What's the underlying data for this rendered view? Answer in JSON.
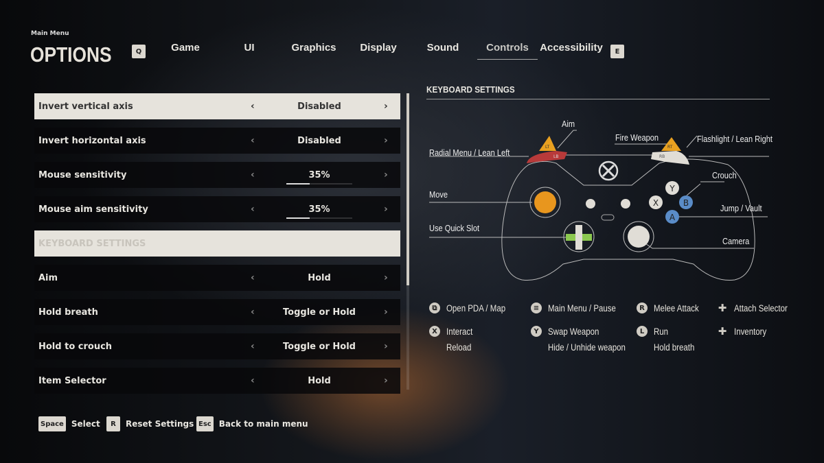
{
  "header": {
    "breadcrumb": "Main Menu",
    "title": "OPTIONS",
    "prev_key": "Q",
    "next_key": "E",
    "tabs": [
      {
        "label": "Game"
      },
      {
        "label": "UI"
      },
      {
        "label": "Graphics"
      },
      {
        "label": "Display"
      },
      {
        "label": "Sound"
      },
      {
        "label": "Controls",
        "active": true
      },
      {
        "label": "Accessibility"
      }
    ]
  },
  "settings": [
    {
      "label": "Invert vertical axis",
      "value": "Disabled",
      "selected": true
    },
    {
      "label": "Invert horizontal axis",
      "value": "Disabled"
    },
    {
      "label": "Mouse sensitivity",
      "value": "35%",
      "progress": 35
    },
    {
      "label": "Mouse aim sensitivity",
      "value": "35%",
      "progress": 35
    },
    {
      "label": "KEYBOARD SETTINGS",
      "header": true
    },
    {
      "label": "Aim",
      "value": "Hold"
    },
    {
      "label": "Hold breath",
      "value": "Toggle or Hold"
    },
    {
      "label": "Hold to crouch",
      "value": "Toggle or Hold"
    },
    {
      "label": "Item Selector",
      "value": "Hold"
    }
  ],
  "arrows": {
    "left": "‹",
    "right": "›"
  },
  "panel": {
    "title": "KEYBOARD SETTINGS",
    "controller_labels": {
      "aim": "Aim",
      "radial": "Radial Menu / Lean Left",
      "fire": "Fire Weapon",
      "flashlight": "Flashlight / Lean Right",
      "crouch": "Crouch",
      "move": "Move",
      "jump": "Jump / Vault",
      "quick_slot": "Use Quick Slot",
      "camera": "Camera"
    },
    "button_glyphs": {
      "lt": "LT",
      "lb": "LB",
      "rt": "RT",
      "rb": "RB",
      "y": "Y",
      "x": "X",
      "b": "B",
      "a": "A"
    },
    "legend": [
      {
        "icon": "view-button-icon",
        "glyph": "⧉",
        "lines": [
          "Open PDA / Map"
        ]
      },
      {
        "icon": "menu-button-icon",
        "glyph": "≡",
        "lines": [
          "Main Menu / Pause"
        ]
      },
      {
        "icon": "right-stick-click-icon",
        "glyph": "R",
        "lines": [
          "Melee Attack"
        ]
      },
      {
        "icon": "dpad-left-right-icon",
        "glyph": "✚",
        "lines": [
          "Attach Selector"
        ]
      },
      {
        "icon": "x-button-icon",
        "glyph": "X",
        "lines": [
          "Interact",
          "Reload"
        ]
      },
      {
        "icon": "y-button-icon",
        "glyph": "Y",
        "lines": [
          "Swap Weapon",
          "Hide / Unhide weapon"
        ]
      },
      {
        "icon": "left-stick-click-icon",
        "glyph": "L",
        "lines": [
          "Run",
          "Hold breath"
        ]
      },
      {
        "icon": "dpad-up-down-icon",
        "glyph": "✚",
        "lines": [
          "Inventory"
        ]
      }
    ]
  },
  "colors": {
    "lt": "#e8a020",
    "lb": "#b83a3a",
    "b_a": "#5a8cc8",
    "dpad": "#8cc850",
    "stick": "#e8961e"
  },
  "footer": [
    {
      "key": "Space",
      "label": "Select"
    },
    {
      "key": "R",
      "label": "Reset Settings"
    },
    {
      "key": "Esc",
      "label": "Back to main menu"
    }
  ]
}
